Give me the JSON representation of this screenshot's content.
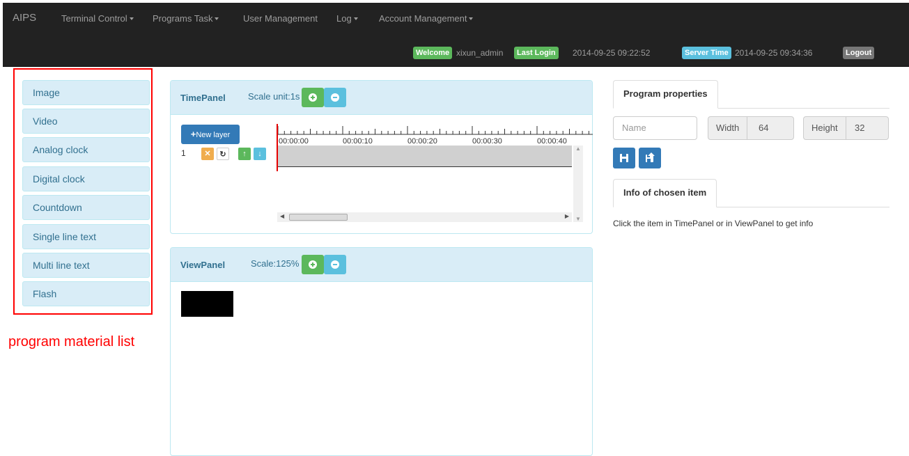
{
  "navbar": {
    "brand": "AIPS",
    "menus": [
      {
        "label": "Terminal Control",
        "dropdown": true
      },
      {
        "label": "Programs Task",
        "dropdown": true
      },
      {
        "label": "User Management",
        "dropdown": false
      },
      {
        "label": "Log",
        "dropdown": true
      },
      {
        "label": "Account Management",
        "dropdown": true
      }
    ],
    "welcome_label": "Welcome",
    "username": "xixun_admin",
    "last_login_label": "Last Login",
    "last_login_time": "2014-09-25 09:22:52",
    "server_time_label": "Server Time",
    "server_time": "2014-09-25 09:34:36",
    "logout_label": "Logout"
  },
  "materials": {
    "items": [
      "Image",
      "Video",
      "Analog clock",
      "Digital clock",
      "Countdown",
      "Single line text",
      "Multi line text",
      "Flash"
    ],
    "annotation": "program material list"
  },
  "timepanel": {
    "title": "TimePanel",
    "scale": "Scale unit:1s",
    "new_layer_label": "New layer",
    "ruler_labels": [
      "00:00:00",
      "00:00:10",
      "00:00:20",
      "00:00:30",
      "00:00:40"
    ],
    "layer_number": "1"
  },
  "viewpanel": {
    "title": "ViewPanel",
    "scale": "Scale:125%"
  },
  "properties": {
    "tab_label": "Program properties",
    "name_placeholder": "Name",
    "width_label": "Width",
    "width_value": "64",
    "height_label": "Height",
    "height_value": "32"
  },
  "chosen": {
    "tab_label": "Info of chosen item",
    "info_text": "Click the item in TimePanel or in ViewPanel to get info"
  },
  "colors": {
    "navbar_bg": "#222222",
    "label_green": "#5cb85c",
    "label_blue": "#5bc0de",
    "primary": "#337ab7",
    "annotation_red": "#ff0000"
  }
}
